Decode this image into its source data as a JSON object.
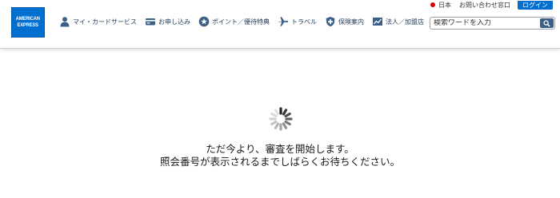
{
  "brand": {
    "logo_line1": "AMERICAN",
    "logo_line2": "EXPRESS",
    "color": "#016fd0"
  },
  "utility": {
    "language": "日本",
    "contact": "お問い合わせ窓口",
    "login": "ログイン"
  },
  "nav": {
    "items": [
      {
        "label": "マイ・カードサービス",
        "icon": "person-icon"
      },
      {
        "label": "お申し込み",
        "icon": "card-icon"
      },
      {
        "label": "ポイント／優待特典",
        "icon": "star-icon"
      },
      {
        "label": "トラベル",
        "icon": "airplane-icon"
      },
      {
        "label": "保険案内",
        "icon": "shield-icon"
      },
      {
        "label": "法人／加盟店",
        "icon": "chart-icon"
      }
    ]
  },
  "search": {
    "placeholder": "検索ワードを入力"
  },
  "status": {
    "line1": "ただ今より、審査を開始します。",
    "line2": "照会番号が表示されるまでしばらくお待ちください。"
  }
}
